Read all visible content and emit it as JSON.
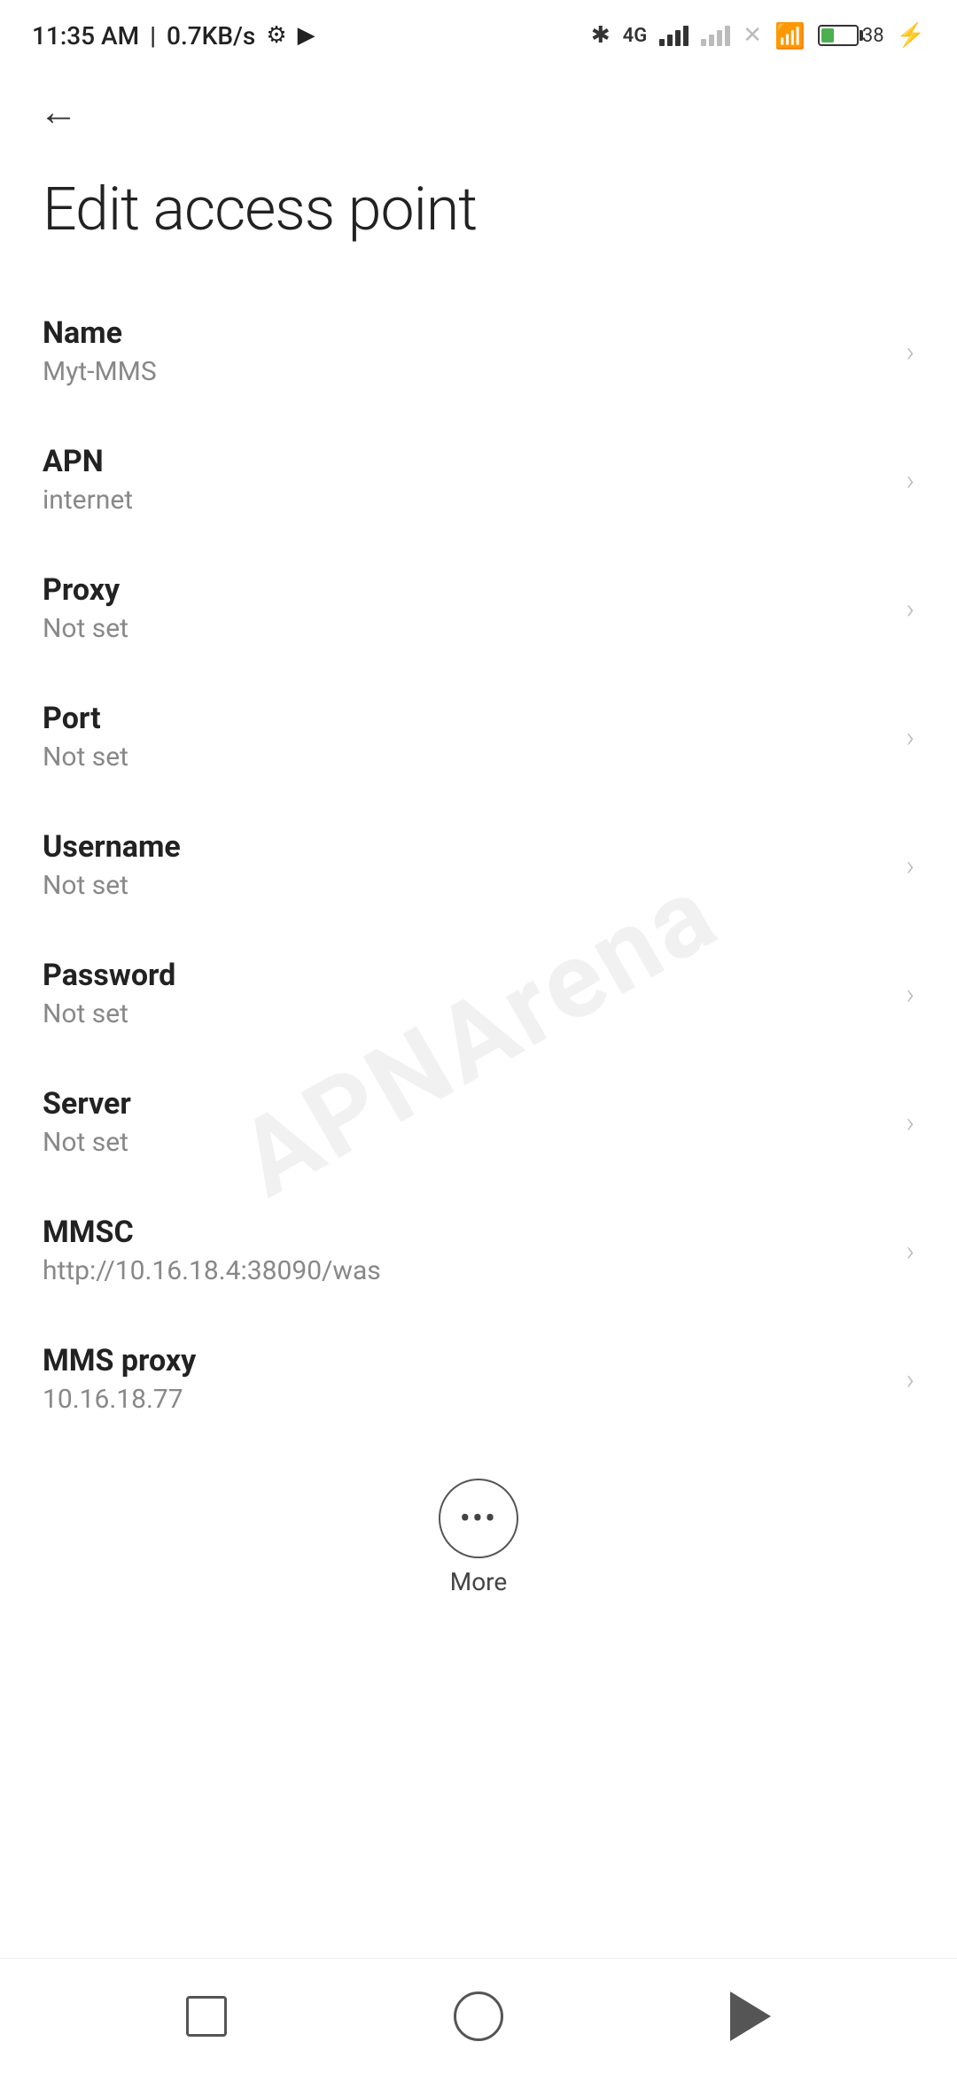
{
  "statusBar": {
    "time": "11:35 AM",
    "speed": "0.7KB/s"
  },
  "toolbar": {
    "backLabel": "←"
  },
  "page": {
    "title": "Edit access point"
  },
  "settings": [
    {
      "label": "Name",
      "value": "Myt-MMS"
    },
    {
      "label": "APN",
      "value": "internet"
    },
    {
      "label": "Proxy",
      "value": "Not set"
    },
    {
      "label": "Port",
      "value": "Not set"
    },
    {
      "label": "Username",
      "value": "Not set"
    },
    {
      "label": "Password",
      "value": "Not set"
    },
    {
      "label": "Server",
      "value": "Not set"
    },
    {
      "label": "MMSC",
      "value": "http://10.16.18.4:38090/was"
    },
    {
      "label": "MMS proxy",
      "value": "10.16.18.77"
    }
  ],
  "more": {
    "label": "More"
  },
  "watermark": "APNArena"
}
